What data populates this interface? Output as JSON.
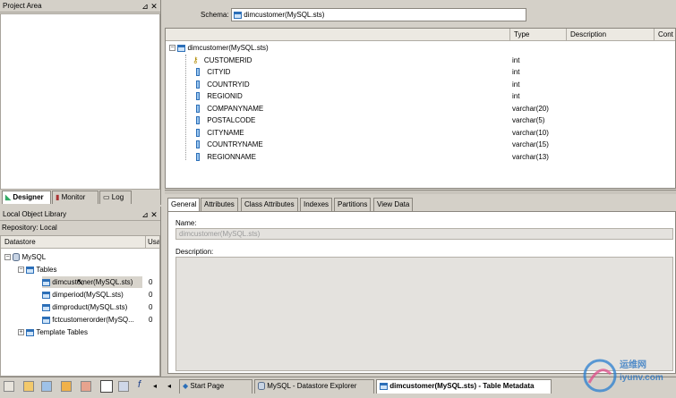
{
  "project_area": {
    "title": "Project Area",
    "tabs": [
      "Designer",
      "Monitor",
      "Log"
    ]
  },
  "local_object_library": {
    "title": "Local Object Library",
    "repository": "Repository: Local",
    "columns": [
      "Datastore",
      "Usa"
    ],
    "tree": {
      "datastore": "MySQL",
      "tables_folder": "Tables",
      "tables": [
        {
          "name": "dimcustomer(MySQL.sts)",
          "usage": "0"
        },
        {
          "name": "dimperiod(MySQL.sts)",
          "usage": "0"
        },
        {
          "name": "dimproduct(MySQL.sts)",
          "usage": "0"
        },
        {
          "name": "fctcustomerorder(MySQ...",
          "usage": "0"
        }
      ],
      "template_folder": "Template Tables"
    }
  },
  "schema_editor": {
    "schema_label": "Schema:",
    "schema_value": "dimcustomer(MySQL.sts)",
    "columns": [
      "Type",
      "Description",
      "Cont"
    ],
    "root_table": "dimcustomer(MySQL.sts)",
    "fields": [
      {
        "name": "CUSTOMERID",
        "type": "int",
        "key": true
      },
      {
        "name": "CITYID",
        "type": "int",
        "key": false
      },
      {
        "name": "COUNTRYID",
        "type": "int",
        "key": false
      },
      {
        "name": "REGIONID",
        "type": "int",
        "key": false
      },
      {
        "name": "COMPANYNAME",
        "type": "varchar(20)",
        "key": false
      },
      {
        "name": "POSTALCODE",
        "type": "varchar(5)",
        "key": false
      },
      {
        "name": "CITYNAME",
        "type": "varchar(10)",
        "key": false
      },
      {
        "name": "COUNTRYNAME",
        "type": "varchar(15)",
        "key": false
      },
      {
        "name": "REGIONNAME",
        "type": "varchar(13)",
        "key": false
      }
    ]
  },
  "properties": {
    "tabs": [
      "General",
      "Attributes",
      "Class Attributes",
      "Indexes",
      "Partitions",
      "View Data"
    ],
    "name_label": "Name:",
    "name_value": "dimcustomer(MySQL.sts)",
    "description_label": "Description:"
  },
  "bottom_tabs": [
    "Start Page",
    "MySQL - Datastore Explorer",
    "dimcustomer(MySQL.sts) - Table Metadata"
  ],
  "watermark": "运维网 iyunv.com"
}
